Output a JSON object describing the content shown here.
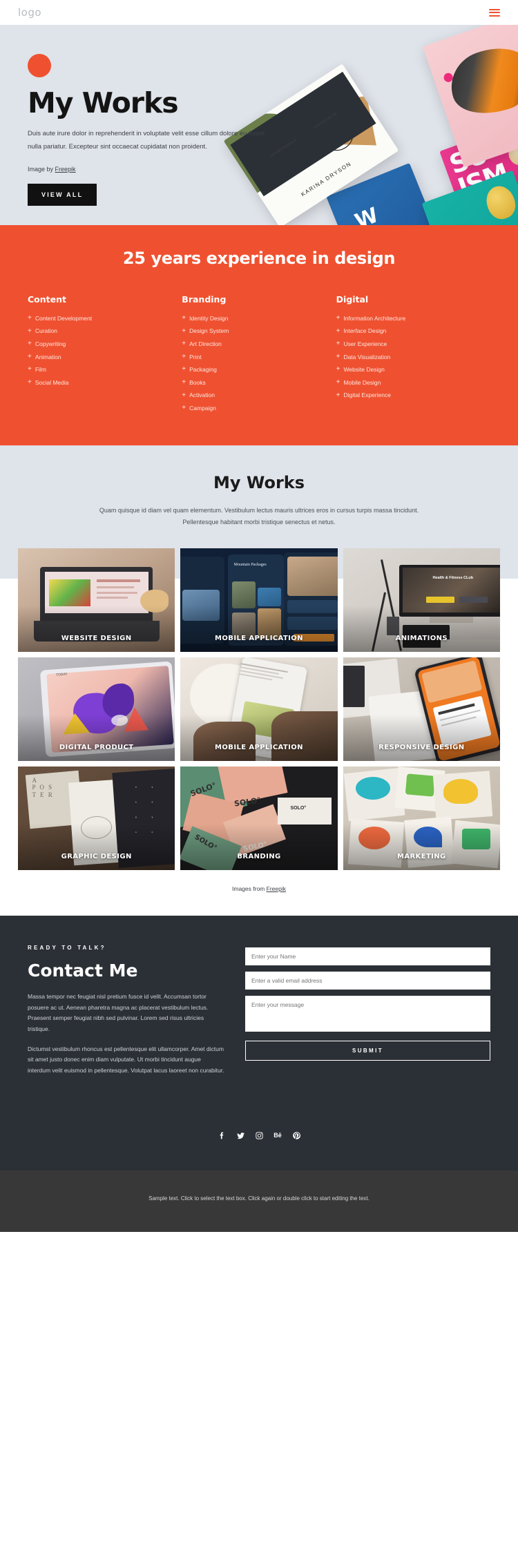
{
  "header": {
    "logo": "logo",
    "menu_icon": "hamburger-icon"
  },
  "hero": {
    "title": "My Works",
    "paragraph": "Duis aute irure dolor in reprehenderit in voluptate velit esse cillum dolore eu fugiat nulla pariatur. Excepteur sint occaecat cupidatat non proident.",
    "credit_prefix": "Image by ",
    "credit_link": "Freepik",
    "button": "VIEW ALL",
    "accent_color": "#ef5130",
    "bg_color": "#dfe3ea",
    "collage": {
      "card_name": "KARINA DRYSON",
      "card_email": "karina@company.com",
      "card_phone": "(+44) 0123 4567 89",
      "poster_line1": "SU",
      "poster_line2": "ISM"
    }
  },
  "experience": {
    "heading": "25 years experience in design",
    "bg_color": "#ef5130",
    "columns": [
      {
        "title": "Content",
        "items": [
          "Content Development",
          "Curation",
          "Copywriting",
          "Animation",
          "Film",
          "Social Media"
        ]
      },
      {
        "title": "Branding",
        "items": [
          "Identity Design",
          "Design System",
          "Art Direction",
          "Print",
          "Packaging",
          "Books",
          "Activation",
          "Campaign"
        ]
      },
      {
        "title": "Digital",
        "items": [
          "Information Architecture",
          "Interface Design",
          "User Experience",
          "Data Visualization",
          "Website Design",
          "Mobile Design",
          "Digital Experience"
        ]
      }
    ]
  },
  "works": {
    "heading": "My Works",
    "description": "Quam quisque id diam vel quam elementum. Vestibulum lectus mauris ultrices eros in cursus turpis massa tincidunt. Pellentesque habitant morbi tristique senectus et netus.",
    "tiles": [
      {
        "label": "WEBSITE DESIGN",
        "art": "laptop-breakfast"
      },
      {
        "label": "MOBILE APPLICATION",
        "art": "mountain-packages-app"
      },
      {
        "label": "ANIMATIONS",
        "art": "imac-fitness-club"
      },
      {
        "label": "DIGITAL PRODUCT",
        "art": "tablet-illustration"
      },
      {
        "label": "MOBILE APPLICATION",
        "art": "hands-phone-food"
      },
      {
        "label": "RESPONSIVE DESIGN",
        "art": "phone-laptop-orange"
      },
      {
        "label": "GRAPHIC DESIGN",
        "art": "poster-mockups"
      },
      {
        "label": "BRANDING",
        "art": "solo-brand-cards"
      },
      {
        "label": "MARKETING",
        "art": "stationery-flatlay"
      }
    ],
    "images_credit_prefix": "Images from ",
    "images_credit_link": "Freepik"
  },
  "contact": {
    "eyebrow": "READY TO TALK?",
    "heading": "Contact Me",
    "paragraph1": "Massa tempor nec feugiat nisl pretium fusce id velit. Accumsan tortor posuere ac ut. Aenean pharetra magna ac placerat vestibulum lectus. Praesent semper feugiat nibh sed pulvinar. Lorem sed risus ultricies tristique.",
    "paragraph2": "Dictumst vestibulum rhoncus est pellentesque elit ullamcorper. Amet dictum sit amet justo donec enim diam vulputate. Ut morbi tincidunt augue interdum velit euismod in pellentesque. Volutpat lacus laoreet non curabitur.",
    "name_placeholder": "Enter your Name",
    "email_placeholder": "Enter a valid email address",
    "message_placeholder": "Enter your message",
    "submit_label": "SUBMIT",
    "bg_color": "#2b3036",
    "socials": [
      {
        "name": "facebook-icon"
      },
      {
        "name": "twitter-icon"
      },
      {
        "name": "instagram-icon"
      },
      {
        "name": "behance-icon"
      },
      {
        "name": "pinterest-icon"
      }
    ]
  },
  "footer": {
    "text": "Sample text. Click to select the text box. Click again or double click to start editing the text.",
    "bg_color": "#383838"
  }
}
